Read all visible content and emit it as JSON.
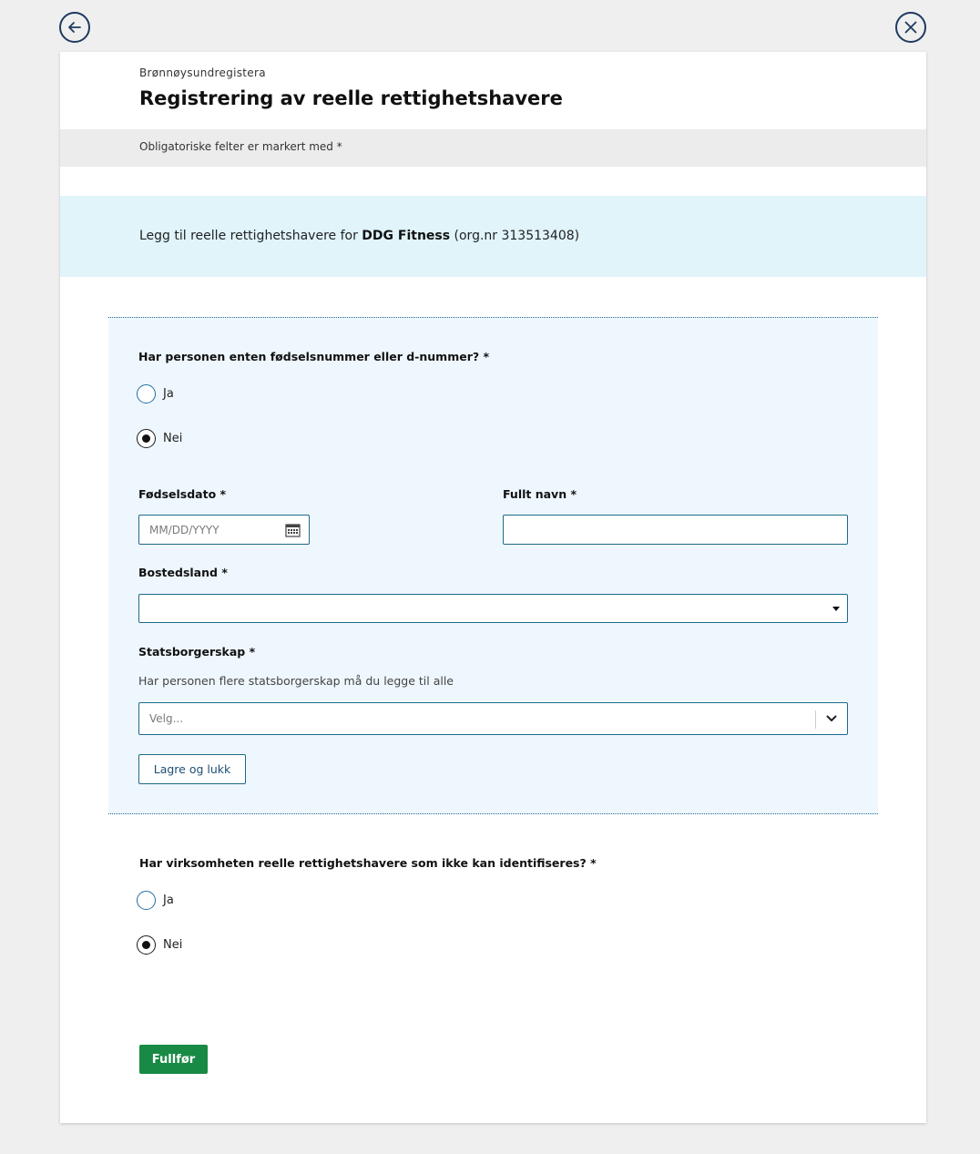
{
  "nav": {
    "back_icon": "arrow-left-icon",
    "close_icon": "close-icon"
  },
  "header": {
    "org": "Brønnøysundregistera",
    "title": "Registrering av reelle rettighetshavere"
  },
  "required_note": "Obligatoriske felter er markert med *",
  "info": {
    "prefix": "Legg til reelle rettighetshavere for ",
    "company": "DDG Fitness",
    "suffix": " (org.nr 313513408)"
  },
  "person_form": {
    "id_question": "Har personen enten fødselsnummer eller d-nummer? *",
    "options": [
      {
        "label": "Ja",
        "checked": false
      },
      {
        "label": "Nei",
        "checked": true
      }
    ],
    "birth_date": {
      "label": "Fødselsdato *",
      "placeholder": "MM/DD/YYYY",
      "icon": "calendar-icon"
    },
    "full_name": {
      "label": "Fullt navn *",
      "value": ""
    },
    "residence": {
      "label": "Bostedsland *",
      "value": ""
    },
    "citizenship": {
      "label": "Statsborgerskap *",
      "help": "Har personen flere statsborgerskap må du legge til alle",
      "placeholder": "Velg..."
    },
    "save_button": "Lagre og lukk"
  },
  "unidentified": {
    "question": "Har virksomheten reelle rettighetshavere som ikke kan identifiseres? *",
    "options": [
      {
        "label": "Ja",
        "checked": false
      },
      {
        "label": "Nei",
        "checked": true
      }
    ]
  },
  "submit_button": "Fullfør",
  "colors": {
    "primary_green": "#188a45",
    "border_blue": "#1e6a8a",
    "info_bg": "#e0f4fa",
    "form_bg": "#eef7fd"
  }
}
